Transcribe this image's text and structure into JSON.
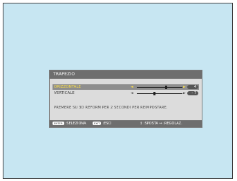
{
  "osd": {
    "title": "TRAPEZIO",
    "rows": [
      {
        "label": "ORIZZONTALE",
        "value": "4",
        "selected": true,
        "level": 0.65
      },
      {
        "label": "VERTICALE",
        "value": "- 7",
        "selected": false,
        "level": 0.38
      }
    ],
    "arrow_left": "◄",
    "arrow_right": "►",
    "message": "PREMERE SU 3D REFORM PER 2 SECONDI PER REIMPOSTARE.",
    "footer": {
      "enter_key": "ENTER",
      "select_label": ":SELEZIONA",
      "exit_key": "EXIT",
      "exit_label": ":ESCI",
      "move_label": "↕ :SPOSTA ↔ :REGOLAZ."
    }
  },
  "colors": {
    "background": "#c7e6f2",
    "osd_bg": "#dcdcdc",
    "header": "#6e6e6e",
    "highlight_text": "#ffe24a"
  }
}
